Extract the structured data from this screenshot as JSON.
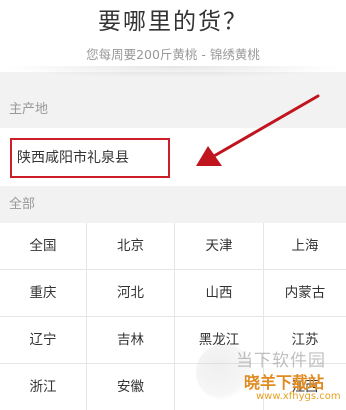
{
  "header": {
    "title": "要哪里的货？",
    "subtitle": "您每周要200斤黄桃 - 锦绣黄桃"
  },
  "main_origin": {
    "label": "主产地",
    "value": "陕西咸阳市礼泉县"
  },
  "all": {
    "label": "全部",
    "regions": [
      "全国",
      "北京",
      "天津",
      "上海",
      "重庆",
      "河北",
      "山西",
      "内蒙古",
      "辽宁",
      "吉林",
      "黑龙江",
      "江苏",
      "浙江",
      "安徽",
      "",
      "江西"
    ]
  },
  "watermark": {
    "site_name": "当下软件园",
    "brand": "晓羊下载站",
    "url": "www.xfhygs.com"
  },
  "colors": {
    "highlight": "#cc1f2a",
    "arrow": "#c0141e",
    "watermark_brand": "#e08a1f"
  }
}
